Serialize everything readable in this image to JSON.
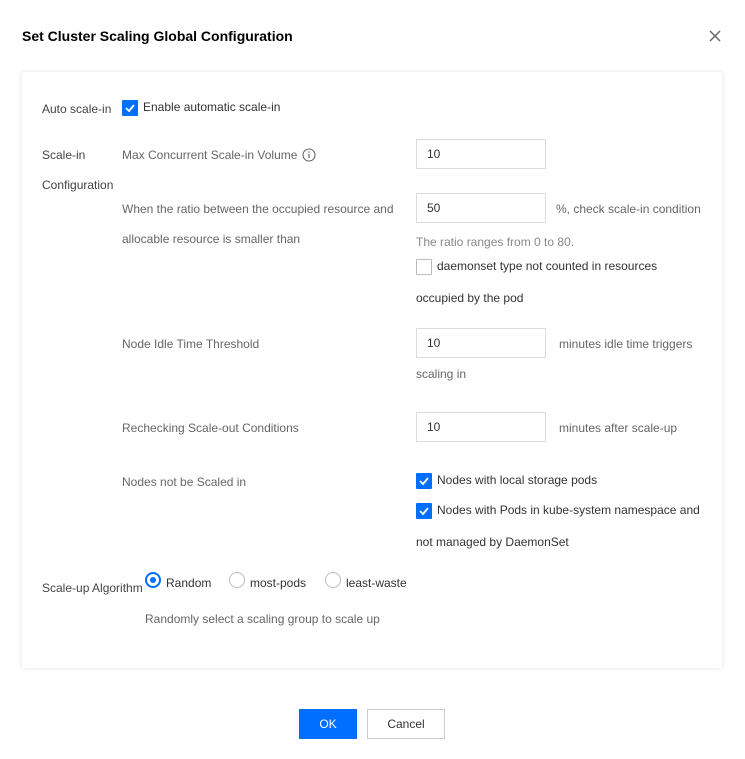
{
  "dialog": {
    "title": "Set Cluster Scaling Global Configuration"
  },
  "auto_scale_in": {
    "label": "Auto scale-in",
    "checkbox_label": "Enable automatic scale-in",
    "checked": true
  },
  "scale_in_config": {
    "label_line1": "Scale-in",
    "label_line2": "Configuration",
    "max_concurrent": {
      "label": "Max Concurrent Scale-in Volume",
      "value": "10"
    },
    "ratio": {
      "label_line1": "When the ratio between the occupied resource and",
      "label_line2": "allocable resource is smaller than",
      "value": "50",
      "suffix": "%, check scale-in condition",
      "hint": "The ratio ranges from 0 to 80.",
      "daemonset_label_line1": "daemonset type not counted in resources",
      "daemonset_label_line2": "occupied by the pod",
      "daemonset_checked": false
    },
    "idle_threshold": {
      "label": "Node Idle Time Threshold",
      "value": "10",
      "suffix_line1": "minutes idle time triggers",
      "suffix_line2": "scaling in"
    },
    "recheck": {
      "label": "Rechecking Scale-out Conditions",
      "value": "10",
      "suffix": "minutes after scale-up"
    },
    "not_scaled": {
      "label": "Nodes not be Scaled in",
      "option1": "Nodes with local storage pods",
      "option1_checked": true,
      "option2_line1": "Nodes with Pods in kube-system namespace and",
      "option2_line2": "not managed by DaemonSet",
      "option2_checked": true
    }
  },
  "scale_up": {
    "label": "Scale-up Algorithm",
    "options": [
      "Random",
      "most-pods",
      "least-waste"
    ],
    "selected": "Random",
    "description": "Randomly select a scaling group to scale up"
  },
  "footer": {
    "ok_label": "OK",
    "cancel_label": "Cancel"
  },
  "colors": {
    "accent": "#006eff"
  }
}
